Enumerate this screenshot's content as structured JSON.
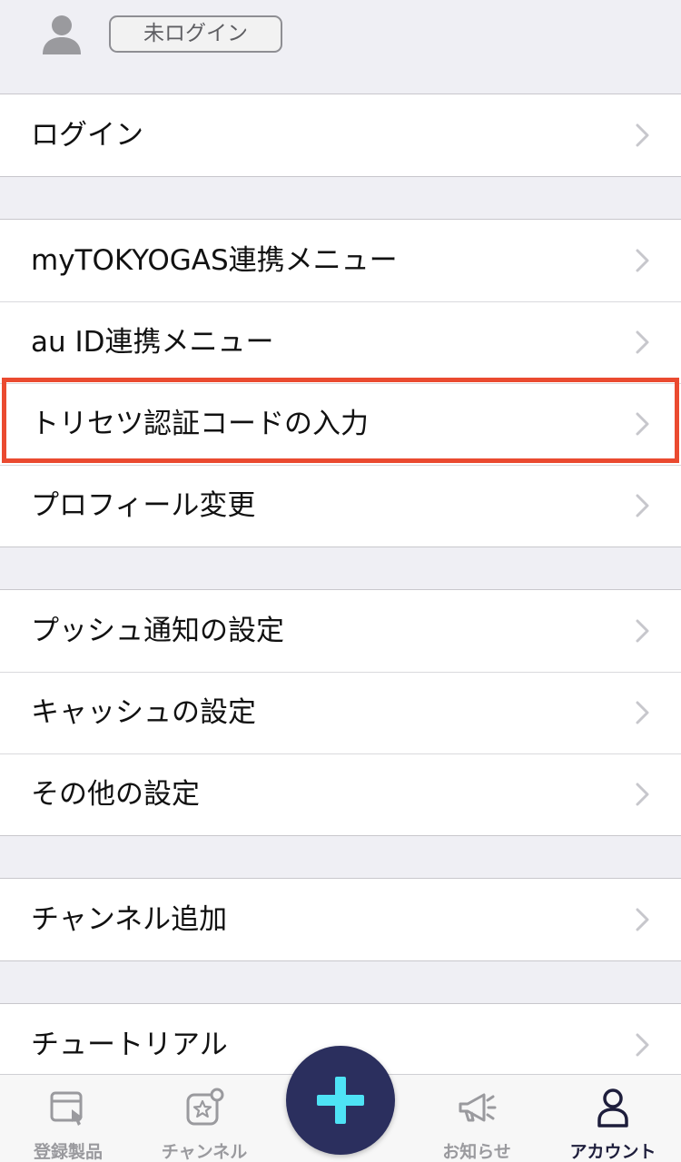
{
  "header": {
    "status": "未ログイン"
  },
  "groups": [
    {
      "items": [
        "ログイン"
      ]
    },
    {
      "items": [
        "myTOKYOGAS連携メニュー",
        "au ID連携メニュー",
        "トリセツ認証コードの入力",
        "プロフィール変更"
      ]
    },
    {
      "items": [
        "プッシュ通知の設定",
        "キャッシュの設定",
        "その他の設定"
      ]
    },
    {
      "items": [
        "チャンネル追加"
      ]
    },
    {
      "items": [
        "チュートリアル"
      ]
    }
  ],
  "highlighted_item": "トリセツ認証コードの入力",
  "tabbar": {
    "tabs": [
      {
        "label": "登録製品",
        "icon": "registered-products-icon",
        "active": false
      },
      {
        "label": "チャンネル",
        "icon": "channel-icon",
        "active": false
      },
      {
        "label": "",
        "icon": "add-icon",
        "active": false
      },
      {
        "label": "お知らせ",
        "icon": "megaphone-icon",
        "active": false
      },
      {
        "label": "アカウント",
        "icon": "person-icon",
        "active": true
      }
    ]
  },
  "colors": {
    "background": "#efeff4",
    "highlight": "#ea4a30",
    "fab": "#2b2f5e",
    "fab_plus": "#4ee3f5",
    "tab_active": "#1e1e3c",
    "tab_inactive": "#9a9a9e"
  }
}
